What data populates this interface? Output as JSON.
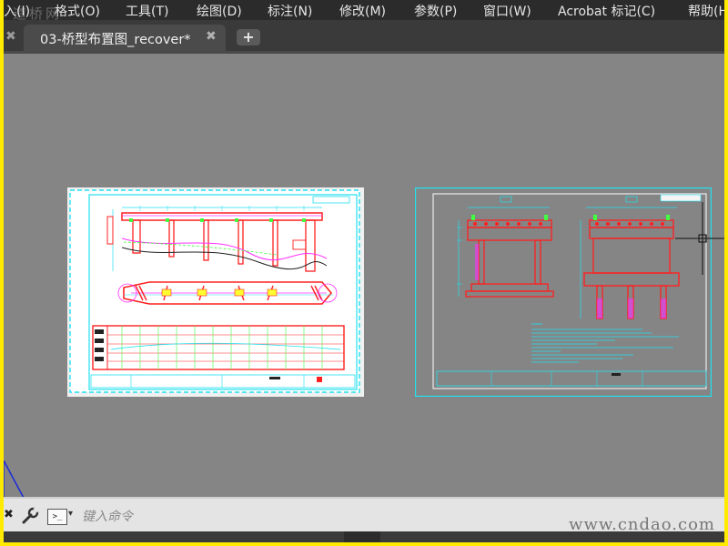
{
  "menu": {
    "items": [
      "入(I)",
      "格式(O)",
      "工具(T)",
      "绘图(D)",
      "标注(N)",
      "修改(M)",
      "参数(P)",
      "窗口(W)",
      "Acrobat 标记(C)",
      "帮助(H"
    ]
  },
  "watermark": {
    "top_left": "道桥网",
    "bottom_right": "www.cndao.com"
  },
  "tabs": {
    "document": "03-桥型布置图_recover*",
    "new_tab": "+",
    "close": "✖"
  },
  "command": {
    "placeholder": "键入命令",
    "prompt_icon": ">_",
    "close": "✖"
  },
  "colors": {
    "canvas": "#858585",
    "menubar": "#2b2b2b",
    "frame": "#ffea00",
    "cad_cyan": "#21e0f0",
    "cad_red": "#ff2020",
    "cad_magenta": "#ff30ff",
    "cad_green": "#40ff40",
    "cad_yellow": "#ffff30"
  }
}
